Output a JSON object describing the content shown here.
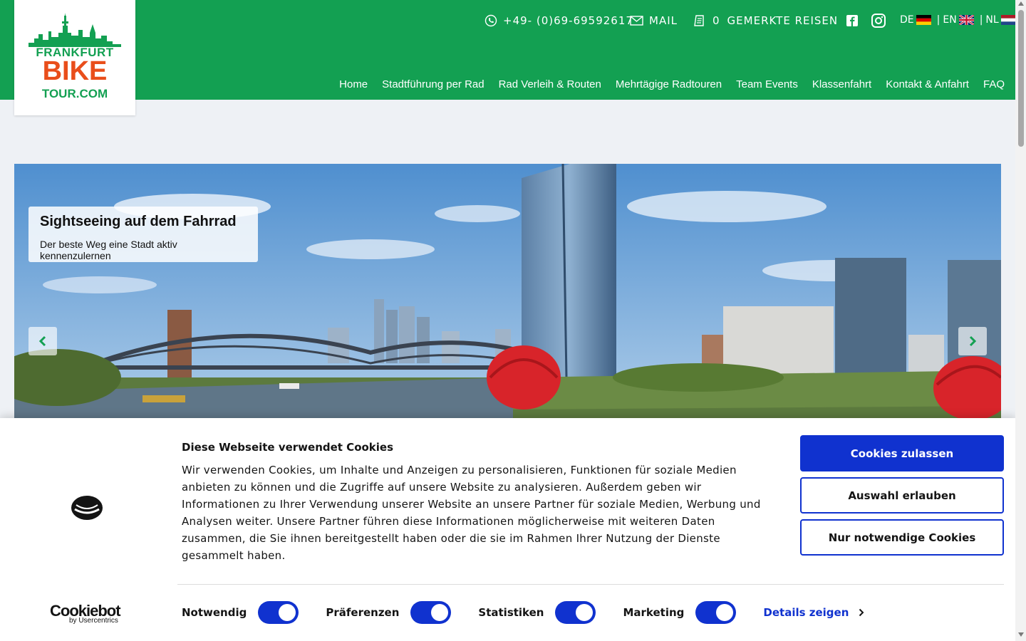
{
  "logo": {
    "line1": "FRANKFURT",
    "line2": "BIKE",
    "line3": "TOUR.COM",
    "brand_green": "#13a052",
    "brand_orange": "#e94e1b"
  },
  "header": {
    "background": "#13a052",
    "phone": "+49- (0)69-69592617",
    "mail": "MAIL",
    "saved_count": "0",
    "saved_label": "GEMERKTE REISEN",
    "languages": [
      {
        "code": "DE"
      },
      {
        "code": "EN"
      },
      {
        "code": "NL"
      }
    ]
  },
  "nav": {
    "items": [
      {
        "label": "Home"
      },
      {
        "label": "Stadtführung per Rad"
      },
      {
        "label": "Rad Verleih & Routen"
      },
      {
        "label": "Mehrtägige Radtouren"
      },
      {
        "label": "Team Events"
      },
      {
        "label": "Klassenfahrt"
      },
      {
        "label": "Kontakt & Anfahrt"
      },
      {
        "label": "FAQ"
      }
    ]
  },
  "slider": {
    "caption_title": "Sightseeing auf dem Fahrrad",
    "caption_text": "Der beste Weg eine Stadt aktiv kennenzulernen"
  },
  "cookie_banner": {
    "title": "Diese Webseite verwendet Cookies",
    "text": "Wir verwenden Cookies, um Inhalte und Anzeigen zu personalisieren, Funktionen für soziale Medien anbieten zu können und die Zugriffe auf unsere Website zu analysieren. Außerdem geben wir Informationen zu Ihrer Verwendung unserer Website an unsere Partner für soziale Medien, Werbung und Analysen weiter. Unsere Partner führen diese Informationen möglicherweise mit weiteren Daten zusammen, die Sie ihnen bereitgestellt haben oder die sie im Rahmen Ihrer Nutzung der Dienste gesammelt haben.",
    "btn_allow": "Cookies zulassen",
    "btn_selection": "Auswahl erlauben",
    "btn_necessary": "Nur notwendige Cookies",
    "toggles": [
      {
        "label": "Notwendig",
        "on": true
      },
      {
        "label": "Präferenzen",
        "on": true
      },
      {
        "label": "Statistiken",
        "on": true
      },
      {
        "label": "Marketing",
        "on": true
      }
    ],
    "details": "Details zeigen",
    "brand": "Cookiebot",
    "brand_sub": "by Usercentrics",
    "accent": "#1032cf"
  }
}
